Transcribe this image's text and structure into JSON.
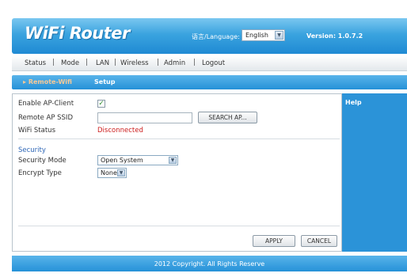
{
  "header": {
    "logo": "WiFi Router",
    "language_label": "语言/Language:",
    "language_selected": "English",
    "version": "Version: 1.0.7.2"
  },
  "menu": {
    "status": "Status",
    "mode": "Mode",
    "lan": "LAN",
    "wireless": "Wireless",
    "admin": "Admin",
    "logout": "Logout"
  },
  "subnav": {
    "active_tab": "Remote-Wifi",
    "setup_tab": "Setup"
  },
  "form": {
    "enable_ap_client_label": "Enable AP-Client",
    "enable_ap_client_checked": true,
    "remote_ssid_label": "Remote AP SSID",
    "remote_ssid_value": "",
    "search_button": "SEARCH AP...",
    "wifi_status_label": "WiFi Status",
    "wifi_status_value": "Disconnected",
    "security_section": "Security",
    "security_mode_label": "Security Mode",
    "security_mode_value": "Open System",
    "encrypt_type_label": "Encrypt Type",
    "encrypt_type_value": "None",
    "apply_button": "APPLY",
    "cancel_button": "CANCEL"
  },
  "help": {
    "title": "Help"
  },
  "footer": {
    "copyright": "2012 Copyright. All Rights Reserve"
  },
  "colors": {
    "brand_blue": "#2591d8",
    "status_red": "#cc1d1d",
    "active_tab": "#f6c896"
  }
}
